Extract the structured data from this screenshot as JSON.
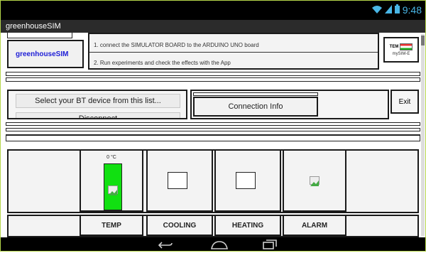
{
  "status_bar": {
    "time": "9:48",
    "wifi_icon": "wifi-icon",
    "signal_icon": "signal-icon",
    "battery_icon": "battery-icon"
  },
  "app": {
    "title": "greenhouseSIM"
  },
  "header": {
    "app_label": "greenhouseSIM",
    "step1": "1. connect the SIMULATOR BOARD to the ARDUINO UNO board",
    "step2": "2. Run experiments and check the effects with the App",
    "logo_text": "mySIM-E",
    "logo_small": "TEM"
  },
  "bt": {
    "select_label": "Select your BT device from this list...",
    "disconnect_label": "Disconnect",
    "connection_info_label": "Connection Info",
    "exit_label": "Exit"
  },
  "sensors": {
    "temp_value": "0 °C",
    "labels": [
      "TEMP",
      "COOLING",
      "HEATING",
      "ALARM"
    ]
  },
  "colors": {
    "accent_green": "#11e011",
    "status_icon": "#49b6e6"
  }
}
